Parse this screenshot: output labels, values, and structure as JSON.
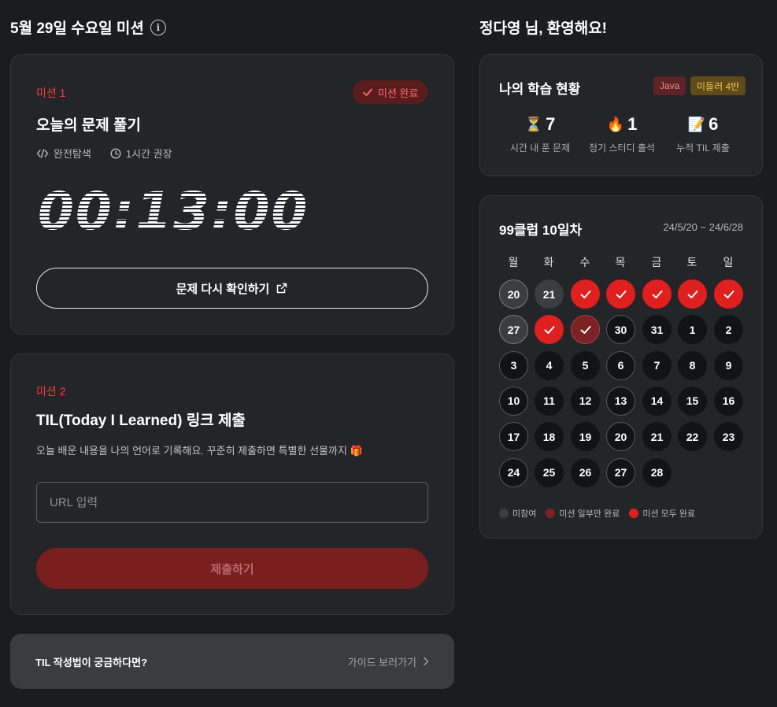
{
  "left_heading": "5월 29일 수요일 미션",
  "right_heading": "정다영 님, 환영해요!",
  "mission1": {
    "label": "미션 1",
    "title": "오늘의 문제 풀기",
    "badge": "미션 완료",
    "tag": "완전탐색",
    "time_hint": "1시간 권장",
    "timer": "00:13:00",
    "review_button": "문제 다시 확인하기"
  },
  "mission2": {
    "label": "미션 2",
    "title": "TIL(Today I Learned) 링크 제출",
    "description": "오늘 배운 내용을 나의 언어로 기록해요. 꾸준히 제출하면 특별한 선물까지 🎁",
    "url_placeholder": "URL 입력",
    "url_value": "",
    "submit_button": "제출하기"
  },
  "guide": {
    "question": "TIL 작성법이 궁금하다면?",
    "link": "가이드 보러가기"
  },
  "status": {
    "title": "나의 학습 현황",
    "tags": [
      {
        "label": "Java",
        "bg": "#5b2426",
        "color": "#ff8a8a"
      },
      {
        "label": "미들러 4반",
        "bg": "#5e4a1a",
        "color": "#f3c64c"
      }
    ],
    "stats": [
      {
        "emoji": "⏳",
        "value": "7",
        "label": "시간 내 푼 문제"
      },
      {
        "emoji": "🔥",
        "value": "1",
        "label": "정기 스터디 출석"
      },
      {
        "emoji": "📝",
        "value": "6",
        "label": "누적 TIL 제출"
      }
    ]
  },
  "calendar": {
    "title": "99클럽 10일차",
    "range": "24/5/20 ~ 24/6/28",
    "weekdays": [
      "월",
      "화",
      "수",
      "목",
      "금",
      "토",
      "일"
    ],
    "days": [
      {
        "label": "20",
        "state": "absent-ring"
      },
      {
        "label": "21",
        "state": "absent"
      },
      {
        "label": "",
        "state": "full"
      },
      {
        "label": "",
        "state": "full"
      },
      {
        "label": "",
        "state": "full"
      },
      {
        "label": "",
        "state": "full"
      },
      {
        "label": "",
        "state": "full"
      },
      {
        "label": "27",
        "state": "absent-ring"
      },
      {
        "label": "",
        "state": "full"
      },
      {
        "label": "",
        "state": "partial"
      },
      {
        "label": "30",
        "state": "ring"
      },
      {
        "label": "31",
        "state": "none"
      },
      {
        "label": "1",
        "state": "none"
      },
      {
        "label": "2",
        "state": "none"
      },
      {
        "label": "3",
        "state": "ring"
      },
      {
        "label": "4",
        "state": "none"
      },
      {
        "label": "5",
        "state": "none"
      },
      {
        "label": "6",
        "state": "ring"
      },
      {
        "label": "7",
        "state": "none"
      },
      {
        "label": "8",
        "state": "none"
      },
      {
        "label": "9",
        "state": "none"
      },
      {
        "label": "10",
        "state": "ring"
      },
      {
        "label": "11",
        "state": "none"
      },
      {
        "label": "12",
        "state": "none"
      },
      {
        "label": "13",
        "state": "ring"
      },
      {
        "label": "14",
        "state": "none"
      },
      {
        "label": "15",
        "state": "none"
      },
      {
        "label": "16",
        "state": "none"
      },
      {
        "label": "17",
        "state": "ring"
      },
      {
        "label": "18",
        "state": "none"
      },
      {
        "label": "19",
        "state": "none"
      },
      {
        "label": "20",
        "state": "ring"
      },
      {
        "label": "21",
        "state": "none"
      },
      {
        "label": "22",
        "state": "none"
      },
      {
        "label": "23",
        "state": "none"
      },
      {
        "label": "24",
        "state": "ring"
      },
      {
        "label": "25",
        "state": "none"
      },
      {
        "label": "26",
        "state": "none"
      },
      {
        "label": "27",
        "state": "ring"
      },
      {
        "label": "28",
        "state": "none"
      }
    ],
    "legend": [
      {
        "label": "미참여",
        "color": "#3b3d41"
      },
      {
        "label": "미션 일부만 완료",
        "color": "#7c2224"
      },
      {
        "label": "미션 모두 완료",
        "color": "#e0201e"
      }
    ]
  },
  "colors": {
    "background": "#1b1c1e",
    "card": "#232528",
    "accent_red": "#e0201e"
  }
}
